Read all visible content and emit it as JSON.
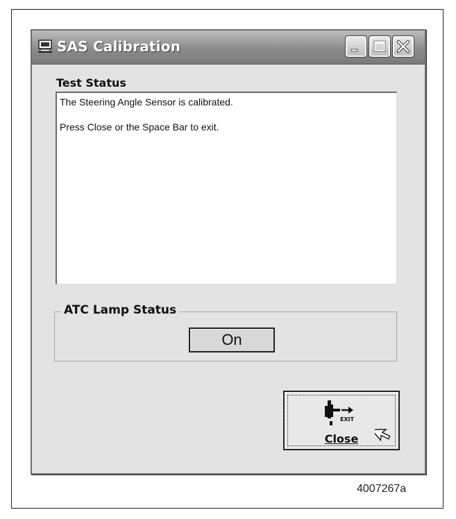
{
  "window": {
    "title": "SAS Calibration",
    "controls": [
      "minimize",
      "maximize",
      "close"
    ]
  },
  "test_status": {
    "label": "Test Status",
    "lines": [
      "The Steering Angle Sensor is calibrated.",
      "Press Close or the Space Bar to exit."
    ]
  },
  "atc_lamp": {
    "label": "ATC Lamp Status",
    "value": "On"
  },
  "close_button": {
    "label": "Close",
    "icon": "exit-icon",
    "icon_text": "EXIT"
  },
  "figure_id": "4007267a"
}
